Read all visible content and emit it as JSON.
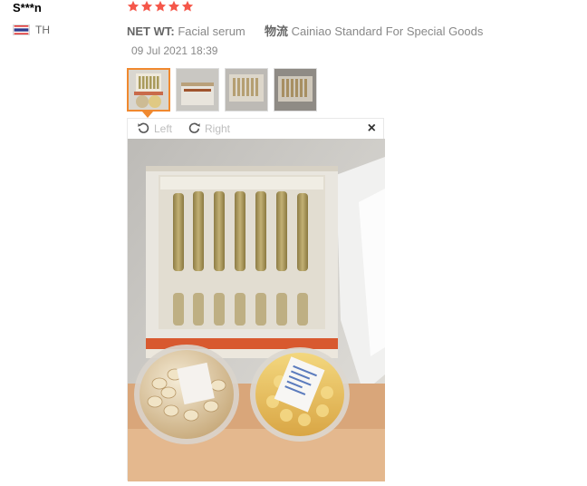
{
  "user": {
    "name": "S***n",
    "country": "TH"
  },
  "review": {
    "rating": 5,
    "net_wt_label": "NET WT:",
    "net_wt_value": "Facial serum",
    "shipping_label": "物流",
    "shipping_value": "Cainiao Standard For Special Goods",
    "date": "09 Jul 2021 18:39"
  },
  "viewer": {
    "rotate_left_label": "Left",
    "rotate_right_label": "Right",
    "close_symbol": "×"
  },
  "thumbnails": [
    {
      "name": "thumb-1",
      "active": true
    },
    {
      "name": "thumb-2",
      "active": false
    },
    {
      "name": "thumb-3",
      "active": false
    },
    {
      "name": "thumb-4",
      "active": false
    }
  ],
  "colors": {
    "star": "#f5574a",
    "active_border": "#f0892f",
    "flag_red": "#e03b3b",
    "flag_blue": "#2d3a8c"
  }
}
